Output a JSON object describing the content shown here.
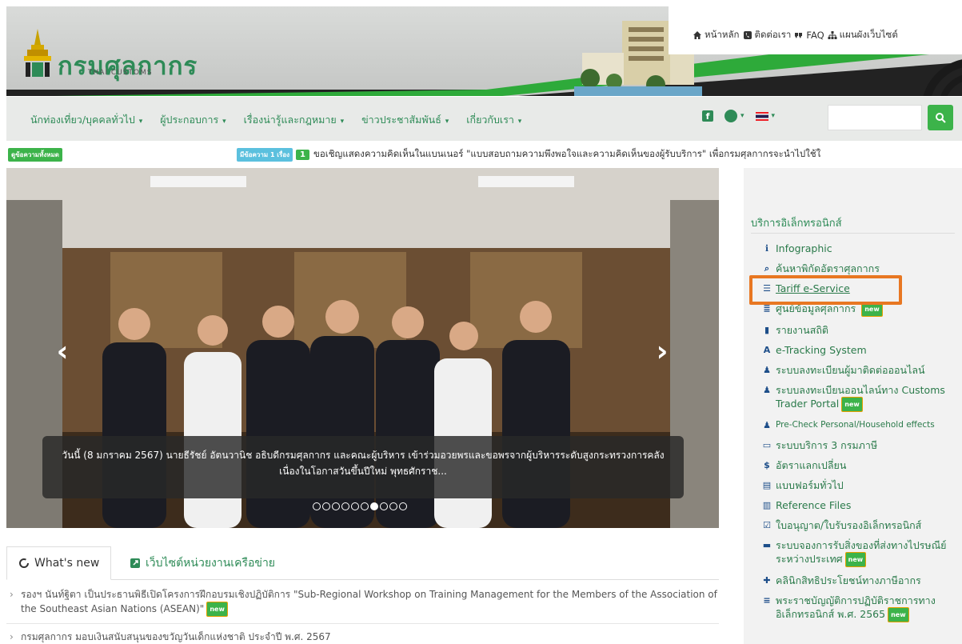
{
  "header": {
    "logo_text": "กรมศุลกากร",
    "logo_sub": "THAI CUSTOMS",
    "top_links": [
      {
        "label": "หน้าหลัก",
        "icon": "home-icon"
      },
      {
        "label": "ติดต่อเรา",
        "icon": "phone-icon"
      },
      {
        "label": "FAQ",
        "icon": "quote-icon"
      },
      {
        "label": "แผนผังเว็บไซต์",
        "icon": "sitemap-icon"
      }
    ]
  },
  "nav": {
    "items": [
      "นักท่องเที่ยว/บุคคลทั่วไป",
      "ผู้ประกอบการ",
      "เรื่องน่ารู้และกฎหมาย",
      "ข่าวประชาสัมพันธ์",
      "เกี่ยวกับเรา"
    ],
    "search_placeholder": ""
  },
  "ticker": {
    "all_label": "ดูข้อความทั้งหมด",
    "count_label": "มีข้อความ 1 เรื่อง",
    "num": "1",
    "text": "ขอเชิญแสดงความคิดเห็นในแบนเนอร์ \"แบบสอบถามความพึงพอใจและความคิดเห็นของผู้รับบริการ\" เพื่อกรมศุลกากรจะนำไปใช้ใ"
  },
  "slider": {
    "caption": "วันนี้ (8 มกราคม 2567) นายธีรัชย์ อัตนวานิช อธิบดีกรมศุลกากร และคณะผู้บริหาร เข้าร่วมอวยพรและขอพรจากผู้บริหารระดับสูงกระทรวงการคลัง เนื่องในโอกาสวันขึ้นปีใหม่ พุทธศักราช...",
    "dots_total": 10,
    "active_dot": 7
  },
  "tabs": {
    "whats_new": "What's new",
    "network": "เว็บไซต์หน่วยงานเครือข่าย"
  },
  "news": [
    "รองฯ นันท์ฐิตา เป็นประธานพิธีเปิดโครงการฝึกอบรมเชิงปฏิบัติการ \"Sub-Regional Workshop on Training Management for the Members of the Association of the Southeast Asian Nations (ASEAN)\"",
    "กรมศุลกากร มอบเงินสนับสนุนของขวัญวันเด็กแห่งชาติ ประจำปี พ.ศ. 2567"
  ],
  "new_badge": "new",
  "panel": {
    "title": "บริการอิเล็กทรอนิกส์",
    "items": [
      {
        "label": "Infographic",
        "icon": "info-icon",
        "new": false
      },
      {
        "label": "ค้นหาพิกัดอัตราศุลกากร",
        "icon": "search-icon",
        "new": false
      },
      {
        "label": "Tariff e-Service",
        "icon": "list-icon",
        "new": false
      },
      {
        "label": "ศูนย์ข้อมูลศุลกากร",
        "icon": "database-icon",
        "new": true
      },
      {
        "label": "รายงานสถิติ",
        "icon": "bar-chart-icon",
        "new": false
      },
      {
        "label": "e-Tracking System",
        "icon": "tracking-icon",
        "new": false
      },
      {
        "label": "ระบบลงทะเบียนผู้มาติดต่อออนไลน์",
        "icon": "user-icon",
        "new": false
      },
      {
        "label": "ระบบลงทะเบียนออนไลน์ทาง Customs Trader Portal",
        "icon": "users-icon",
        "new": true
      },
      {
        "label": "Pre-Check Personal/Household effects",
        "icon": "user-check-icon",
        "new": false
      },
      {
        "label": "ระบบบริการ 3 กรมภาษี",
        "icon": "monitor-icon",
        "new": false
      },
      {
        "label": "อัตราแลกเปลี่ยน",
        "icon": "dollar-icon",
        "new": false
      },
      {
        "label": "แบบฟอร์มทั่วไป",
        "icon": "file-icon",
        "new": false
      },
      {
        "label": "Reference Files",
        "icon": "book-icon",
        "new": false
      },
      {
        "label": "ใบอนุญาต/ใบรับรองอิเล็กทรอนิกส์",
        "icon": "checkbox-icon",
        "new": false
      },
      {
        "label": "ระบบจองการรับสิ่งของที่ส่งทางไปรษณีย์ระหว่างประเทศ",
        "icon": "inbox-icon",
        "new": true
      },
      {
        "label": "คลินิกสิทธิประโยชน์ทางภาษีอากร",
        "icon": "medkit-icon",
        "new": false
      },
      {
        "label": "พระราชบัญญัติการปฏิบัติราชการทางอิเล็กทรอนิกส์ พ.ศ. 2565",
        "icon": "bars-icon",
        "new": true
      }
    ]
  }
}
